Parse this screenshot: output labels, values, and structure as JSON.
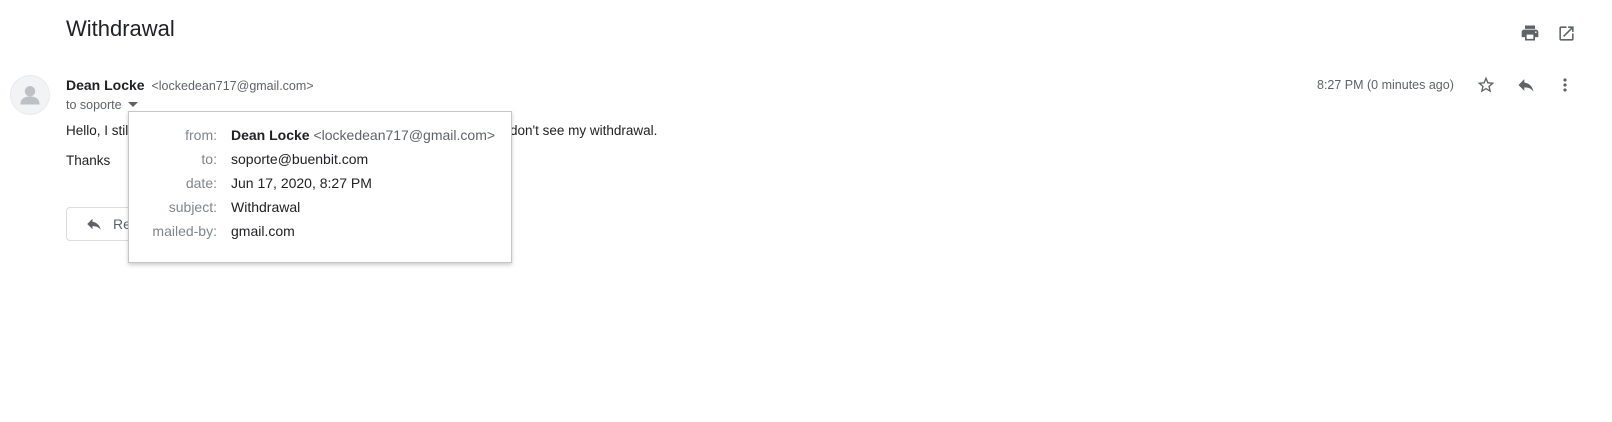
{
  "email": {
    "subject": "Withdrawal",
    "sender": {
      "name": "Dean Locke",
      "email": "<lockedean717@gmail.com>"
    },
    "to_label": "to soporte",
    "timestamp": "8:27 PM (0 minutes ago)",
    "body": {
      "line1_start": "Hello, I still",
      "line1_end": "don't see my withdrawal.",
      "line2": "Thanks"
    },
    "reply_label": "Reply"
  },
  "details_popover": {
    "from_key": "from:",
    "from_name": "Dean Locke",
    "from_email": "<lockedean717@gmail.com>",
    "to_key": "to:",
    "to_value": "soporte@buenbit.com",
    "date_key": "date:",
    "date_value": "Jun 17, 2020, 8:27 PM",
    "subject_key": "subject:",
    "subject_value": "Withdrawal",
    "mailed_by_key": "mailed-by:",
    "mailed_by_value": "gmail.com"
  },
  "icons": {
    "print": "print-icon",
    "open_new_window": "open-in-new-window-icon",
    "star": "star-icon",
    "reply": "reply-icon",
    "more": "more-vert-icon",
    "avatar": "person-avatar-icon",
    "caret": "caret-down-icon"
  },
  "colors": {
    "text_primary": "#202124",
    "text_secondary": "#5f6368",
    "icon": "#5f6368",
    "border": "#dadce0"
  }
}
